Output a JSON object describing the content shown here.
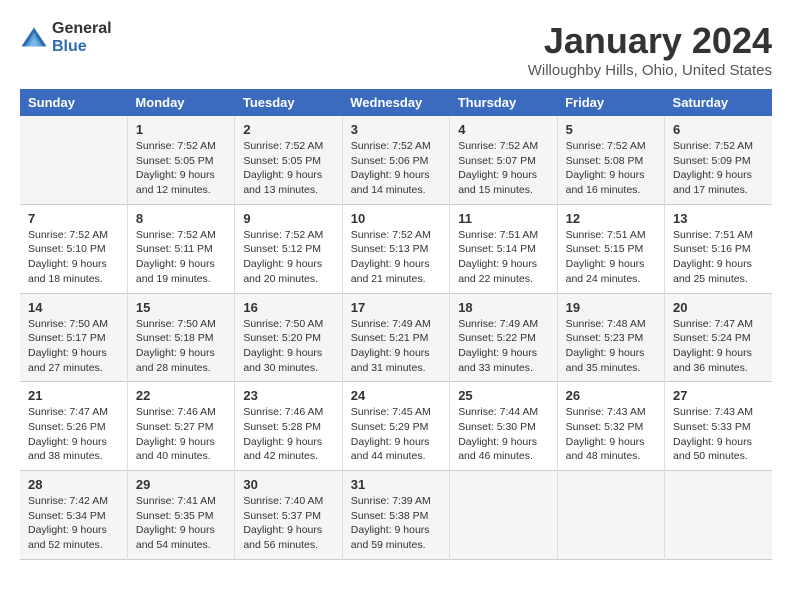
{
  "header": {
    "logo_general": "General",
    "logo_blue": "Blue",
    "title": "January 2024",
    "subtitle": "Willoughby Hills, Ohio, United States"
  },
  "calendar": {
    "days_of_week": [
      "Sunday",
      "Monday",
      "Tuesday",
      "Wednesday",
      "Thursday",
      "Friday",
      "Saturday"
    ],
    "weeks": [
      [
        {
          "day": "",
          "info": ""
        },
        {
          "day": "1",
          "info": "Sunrise: 7:52 AM\nSunset: 5:05 PM\nDaylight: 9 hours and 12 minutes."
        },
        {
          "day": "2",
          "info": "Sunrise: 7:52 AM\nSunset: 5:05 PM\nDaylight: 9 hours and 13 minutes."
        },
        {
          "day": "3",
          "info": "Sunrise: 7:52 AM\nSunset: 5:06 PM\nDaylight: 9 hours and 14 minutes."
        },
        {
          "day": "4",
          "info": "Sunrise: 7:52 AM\nSunset: 5:07 PM\nDaylight: 9 hours and 15 minutes."
        },
        {
          "day": "5",
          "info": "Sunrise: 7:52 AM\nSunset: 5:08 PM\nDaylight: 9 hours and 16 minutes."
        },
        {
          "day": "6",
          "info": "Sunrise: 7:52 AM\nSunset: 5:09 PM\nDaylight: 9 hours and 17 minutes."
        }
      ],
      [
        {
          "day": "7",
          "info": "Sunrise: 7:52 AM\nSunset: 5:10 PM\nDaylight: 9 hours and 18 minutes."
        },
        {
          "day": "8",
          "info": "Sunrise: 7:52 AM\nSunset: 5:11 PM\nDaylight: 9 hours and 19 minutes."
        },
        {
          "day": "9",
          "info": "Sunrise: 7:52 AM\nSunset: 5:12 PM\nDaylight: 9 hours and 20 minutes."
        },
        {
          "day": "10",
          "info": "Sunrise: 7:52 AM\nSunset: 5:13 PM\nDaylight: 9 hours and 21 minutes."
        },
        {
          "day": "11",
          "info": "Sunrise: 7:51 AM\nSunset: 5:14 PM\nDaylight: 9 hours and 22 minutes."
        },
        {
          "day": "12",
          "info": "Sunrise: 7:51 AM\nSunset: 5:15 PM\nDaylight: 9 hours and 24 minutes."
        },
        {
          "day": "13",
          "info": "Sunrise: 7:51 AM\nSunset: 5:16 PM\nDaylight: 9 hours and 25 minutes."
        }
      ],
      [
        {
          "day": "14",
          "info": "Sunrise: 7:50 AM\nSunset: 5:17 PM\nDaylight: 9 hours and 27 minutes."
        },
        {
          "day": "15",
          "info": "Sunrise: 7:50 AM\nSunset: 5:18 PM\nDaylight: 9 hours and 28 minutes."
        },
        {
          "day": "16",
          "info": "Sunrise: 7:50 AM\nSunset: 5:20 PM\nDaylight: 9 hours and 30 minutes."
        },
        {
          "day": "17",
          "info": "Sunrise: 7:49 AM\nSunset: 5:21 PM\nDaylight: 9 hours and 31 minutes."
        },
        {
          "day": "18",
          "info": "Sunrise: 7:49 AM\nSunset: 5:22 PM\nDaylight: 9 hours and 33 minutes."
        },
        {
          "day": "19",
          "info": "Sunrise: 7:48 AM\nSunset: 5:23 PM\nDaylight: 9 hours and 35 minutes."
        },
        {
          "day": "20",
          "info": "Sunrise: 7:47 AM\nSunset: 5:24 PM\nDaylight: 9 hours and 36 minutes."
        }
      ],
      [
        {
          "day": "21",
          "info": "Sunrise: 7:47 AM\nSunset: 5:26 PM\nDaylight: 9 hours and 38 minutes."
        },
        {
          "day": "22",
          "info": "Sunrise: 7:46 AM\nSunset: 5:27 PM\nDaylight: 9 hours and 40 minutes."
        },
        {
          "day": "23",
          "info": "Sunrise: 7:46 AM\nSunset: 5:28 PM\nDaylight: 9 hours and 42 minutes."
        },
        {
          "day": "24",
          "info": "Sunrise: 7:45 AM\nSunset: 5:29 PM\nDaylight: 9 hours and 44 minutes."
        },
        {
          "day": "25",
          "info": "Sunrise: 7:44 AM\nSunset: 5:30 PM\nDaylight: 9 hours and 46 minutes."
        },
        {
          "day": "26",
          "info": "Sunrise: 7:43 AM\nSunset: 5:32 PM\nDaylight: 9 hours and 48 minutes."
        },
        {
          "day": "27",
          "info": "Sunrise: 7:43 AM\nSunset: 5:33 PM\nDaylight: 9 hours and 50 minutes."
        }
      ],
      [
        {
          "day": "28",
          "info": "Sunrise: 7:42 AM\nSunset: 5:34 PM\nDaylight: 9 hours and 52 minutes."
        },
        {
          "day": "29",
          "info": "Sunrise: 7:41 AM\nSunset: 5:35 PM\nDaylight: 9 hours and 54 minutes."
        },
        {
          "day": "30",
          "info": "Sunrise: 7:40 AM\nSunset: 5:37 PM\nDaylight: 9 hours and 56 minutes."
        },
        {
          "day": "31",
          "info": "Sunrise: 7:39 AM\nSunset: 5:38 PM\nDaylight: 9 hours and 59 minutes."
        },
        {
          "day": "",
          "info": ""
        },
        {
          "day": "",
          "info": ""
        },
        {
          "day": "",
          "info": ""
        }
      ]
    ]
  }
}
